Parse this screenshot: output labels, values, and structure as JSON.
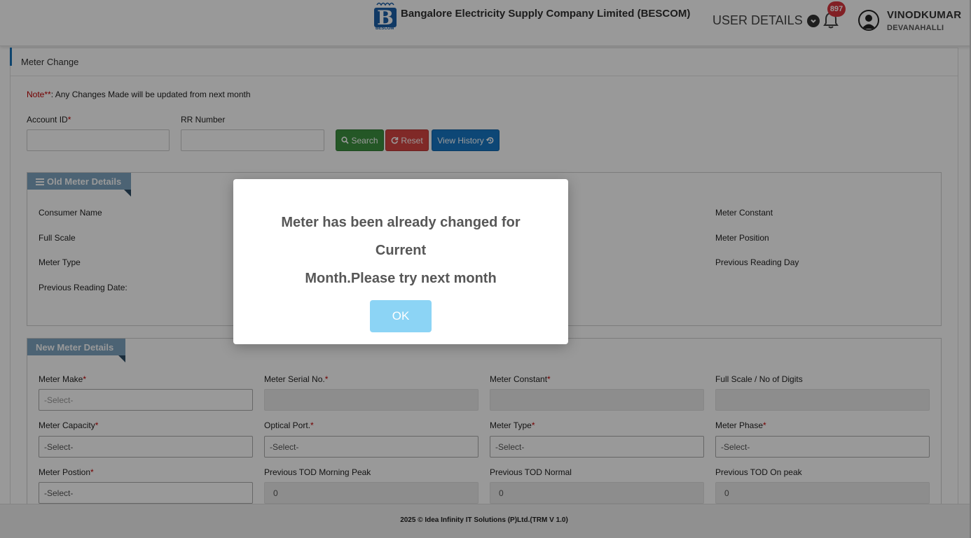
{
  "header": {
    "company_name": "Bangalore Electricity Supply Company Limited (BESCOM)",
    "logo_caption": "BESCOM",
    "user_details_label": "USER DETAILS",
    "notification_count": "897",
    "user_name": "VINODKUMAR",
    "user_location": "DEVANAHALLI"
  },
  "page": {
    "title": "Meter Change",
    "note_prefix": "Note**",
    "note_text": ": Any Changes Made will be updated from next month"
  },
  "search": {
    "account_id_label": "Account ID",
    "rr_number_label": "RR Number",
    "account_id_value": "",
    "rr_number_value": "",
    "search_label": "Search",
    "reset_label": "Reset",
    "view_history_label": "View History"
  },
  "old_meter": {
    "legend": "Old Meter Details",
    "consumer_name_label": "Consumer Name",
    "full_scale_label": "Full Scale",
    "meter_type_label": "Meter Type",
    "previous_reading_date_label": "Previous Reading Date:",
    "meter_constant_label": "Meter Constant",
    "meter_position_label": "Meter Position",
    "previous_reading_day_label": "Previous Reading Day"
  },
  "new_meter": {
    "legend": "New Meter Details",
    "meter_make_label": "Meter Make",
    "meter_serial_label": "Meter Serial No.",
    "meter_constant_label": "Meter Constant",
    "full_scale_digits_label": "Full Scale / No of Digits",
    "meter_capacity_label": "Meter Capacity",
    "optical_port_label": "Optical Port.",
    "meter_type_label": "Meter Type",
    "meter_phase_label": "Meter Phase",
    "meter_position_label": "Meter Postion",
    "prev_tod_morning_label": "Previous TOD Morning Peak",
    "prev_tod_normal_label": "Previous TOD Normal",
    "prev_tod_onpeak_label": "Previous TOD On peak",
    "select_placeholder": "-Select-",
    "meter_make_value": "-Select-",
    "meter_capacity_value": "-Select-",
    "optical_port_value": "-Select-",
    "meter_type_value": "-Select-",
    "meter_phase_value": "-Select-",
    "meter_position_value": "-Select-",
    "prev_tod_morning_value": "0",
    "prev_tod_normal_value": "0",
    "prev_tod_onpeak_value": "0"
  },
  "footer": {
    "text": "2025 © Idea Infinity IT Solutions (P)Ltd.(TRM V 1.0)"
  },
  "modal": {
    "line1": "Meter has been already changed for Current",
    "line2": "Month.Please try next month",
    "ok_label": "OK"
  },
  "colors": {
    "accent": "#1a73b8",
    "search_button": "#3d9140",
    "reset_button": "#d64541",
    "history_button": "#1777c5",
    "legend_bg": "#7fa6c1",
    "ok_button": "#8cd4f5",
    "required": "#c00000"
  },
  "icons": [
    "bescom-logo-icon",
    "chevron-down-circle-icon",
    "bell-icon",
    "user-avatar-icon",
    "search-icon",
    "refresh-icon",
    "history-icon",
    "list-icon"
  ]
}
